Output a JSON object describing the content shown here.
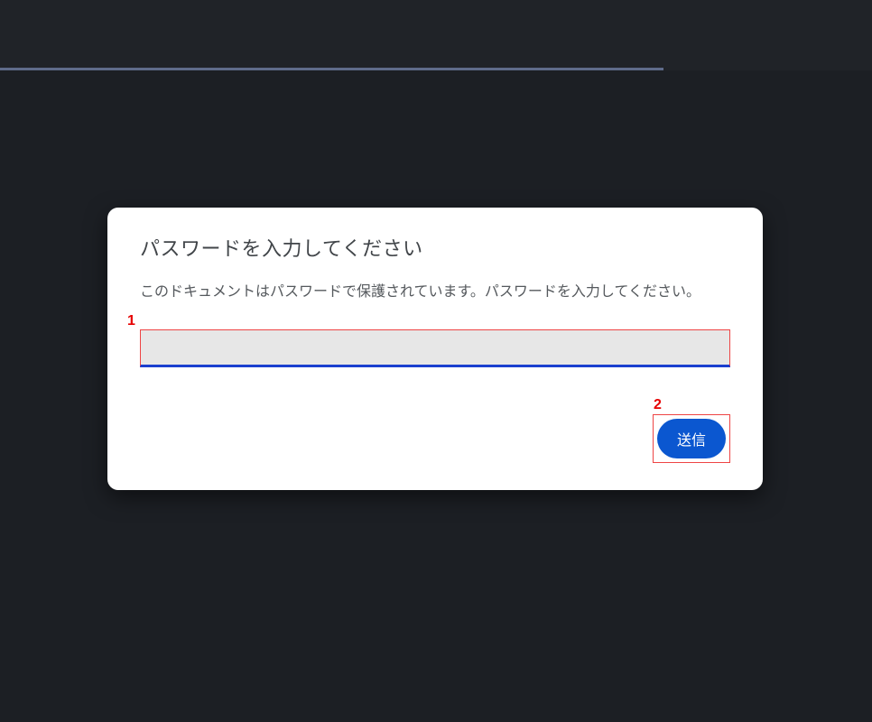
{
  "dialog": {
    "title": "パスワードを入力してください",
    "description": "このドキュメントはパスワードで保護されています。パスワードを入力してください。",
    "password_value": "",
    "submit_label": "送信"
  },
  "annotations": {
    "label1": "1",
    "label2": "2"
  }
}
